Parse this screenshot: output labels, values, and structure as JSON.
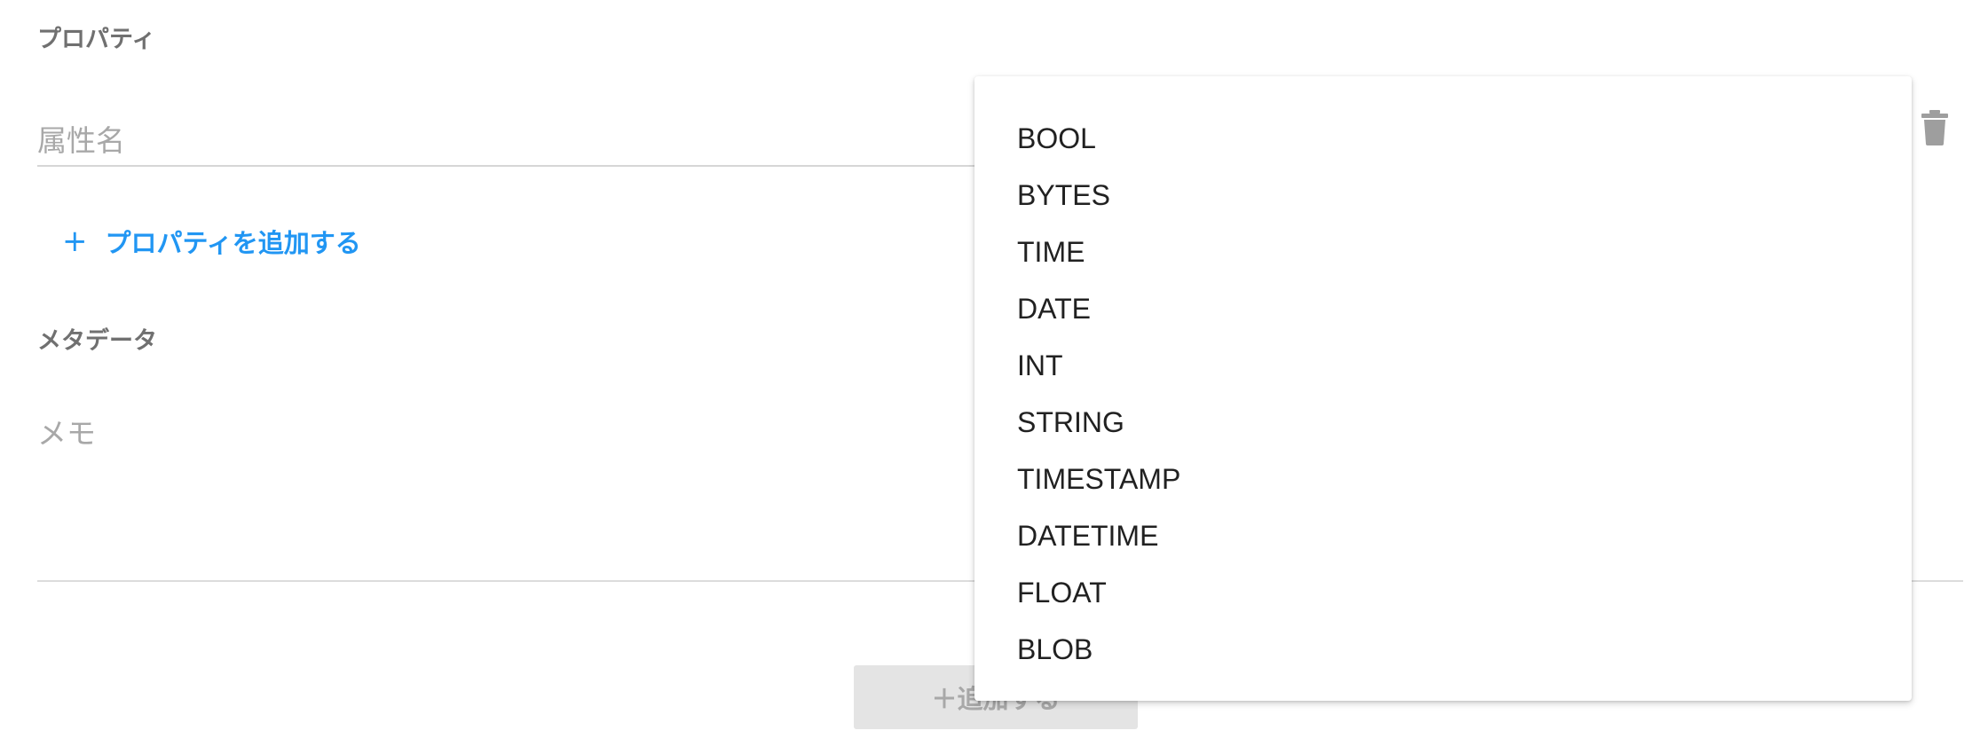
{
  "properties": {
    "title": "プロパティ",
    "attribute_placeholder": "属性名",
    "add_property_label": "プロパティを追加する",
    "add_property_plus": "+"
  },
  "metadata": {
    "title": "メタデータ",
    "memo_placeholder": "メモ"
  },
  "submit": {
    "label": "＋追加する"
  },
  "type_dropdown": {
    "options": [
      "BOOL",
      "BYTES",
      "TIME",
      "DATE",
      "INT",
      "STRING",
      "TIMESTAMP",
      "DATETIME",
      "FLOAT",
      "BLOB"
    ]
  },
  "icons": {
    "delete": "trash-icon"
  },
  "colors": {
    "accent": "#2196f3",
    "section_title": "#707070",
    "placeholder": "#a8a8a8",
    "disabled_button_bg": "#e4e4e4"
  }
}
